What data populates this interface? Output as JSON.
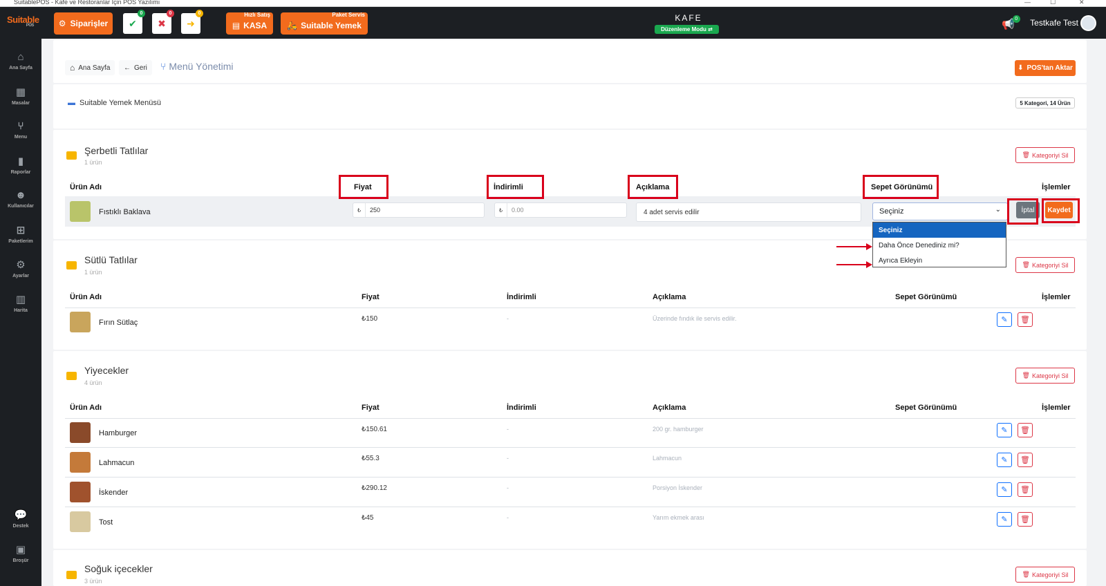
{
  "window": {
    "title": "SuitablePOS - Kafe ve Restoranlar İçin POS Yazılımı"
  },
  "topbar": {
    "logo": "Suitable",
    "logo_sub": "POS",
    "orders": "Siparişler",
    "badge_ok": "0",
    "badge_cancel": "0",
    "badge_pending": "0",
    "quick_sale_title": "Hızlı Satış",
    "quick_sale": "KASA",
    "delivery_title": "Paket Servis",
    "delivery": "Suitable Yemek",
    "venue": "KAFE",
    "edit_mode": "Düzenleme Modu",
    "notif_count": "0",
    "user": "Testkafe Test"
  },
  "sidebar": [
    {
      "label": "Ana Sayfa",
      "icon": "home-icon"
    },
    {
      "label": "Masalar",
      "icon": "table-icon"
    },
    {
      "label": "Menu",
      "icon": "cutlery-icon"
    },
    {
      "label": "Raporlar",
      "icon": "report-icon"
    },
    {
      "label": "Kullanıcılar",
      "icon": "users-icon"
    },
    {
      "label": "Paketlerim",
      "icon": "gift-icon"
    },
    {
      "label": "Ayarlar",
      "icon": "gears-icon"
    },
    {
      "label": "Harita",
      "icon": "map-icon"
    },
    {
      "label": "Destek",
      "icon": "chat-icon"
    },
    {
      "label": "Broşür",
      "icon": "brochure-icon"
    }
  ],
  "header": {
    "home": "Ana Sayfa",
    "back": "Geri",
    "title": "Menü Yönetimi",
    "pos_transfer": "POS'tan Aktar"
  },
  "menu": {
    "name": "Suitable Yemek Menüsü",
    "summary": "5 Kategori, 14 Ürün",
    "delete_category": "Kategoriyi Sil"
  },
  "columns": {
    "name": "Ürün Adı",
    "price": "Fiyat",
    "discounted": "İndirimli",
    "description": "Açıklama",
    "basket_view": "Sepet Görünümü",
    "actions": "İşlemler"
  },
  "categories": [
    {
      "title": "Şerbetli Tatlılar",
      "count": "1 ürün"
    },
    {
      "title": "Sütlü Tatlılar",
      "count": "1 ürün"
    },
    {
      "title": "Yiyecekler",
      "count": "4 ürün"
    },
    {
      "title": "Soğuk içecekler",
      "count": "3 ürün"
    }
  ],
  "edit_row": {
    "name": "Fıstıklı Baklava",
    "currency": "₺",
    "price": "250",
    "discounted": "0.00",
    "description": "4 adet servis edilir",
    "select_value": "Seçiniz",
    "cancel": "İptal",
    "save": "Kaydet"
  },
  "dropdown": [
    "Seçiniz",
    "Daha Önce Denediniz mi?",
    "Ayrıca Ekleyin"
  ],
  "sutlu": [
    {
      "name": "Fırın Sütlaç",
      "price": "₺150",
      "disc": "-",
      "desc": "Üzerinde fındık ile servis edilir."
    }
  ],
  "yiyecek": [
    {
      "name": "Hamburger",
      "price": "₺150.61",
      "disc": "-",
      "desc": "200 gr. hamburger"
    },
    {
      "name": "Lahmacun",
      "price": "₺55.3",
      "disc": "-",
      "desc": "Lahmacun"
    },
    {
      "name": "İskender",
      "price": "₺290.12",
      "disc": "-",
      "desc": "Porsiyon İskender"
    },
    {
      "name": "Tost",
      "price": "₺45",
      "disc": "-",
      "desc": "Yarım ekmek arası"
    }
  ]
}
